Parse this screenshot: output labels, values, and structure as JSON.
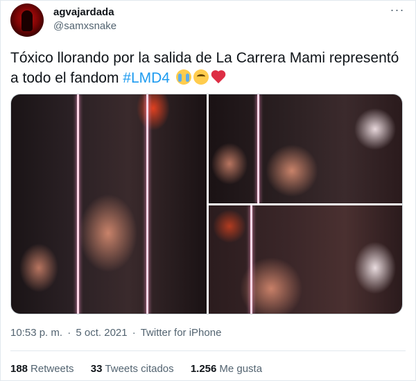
{
  "user": {
    "display_name": "agvajardada",
    "handle": "@samxsnake"
  },
  "more_label": "···",
  "tweet": {
    "text_main": "Tóxico llorando por la salida de La Carrera Mami representó a todo el fandom ",
    "hashtag": "#LMD4",
    "emojis": [
      "loudly-crying-face",
      "pleading-face",
      "red-heart"
    ]
  },
  "media": {
    "images": [
      {
        "name": "photo-1"
      },
      {
        "name": "photo-2"
      },
      {
        "name": "photo-3"
      }
    ]
  },
  "meta": {
    "time": "10:53 p. m.",
    "sep1": "·",
    "date": "5 oct. 2021",
    "sep2": "·",
    "source": "Twitter for iPhone"
  },
  "stats": {
    "retweets_count": "188",
    "retweets_label": "Retweets",
    "quotes_count": "33",
    "quotes_label": "Tweets citados",
    "likes_count": "1.256",
    "likes_label": "Me gusta"
  },
  "colors": {
    "accent": "#1d9bf0",
    "secondary_text": "#536471",
    "primary_text": "#0f1419",
    "heart": "#dd2e44"
  }
}
